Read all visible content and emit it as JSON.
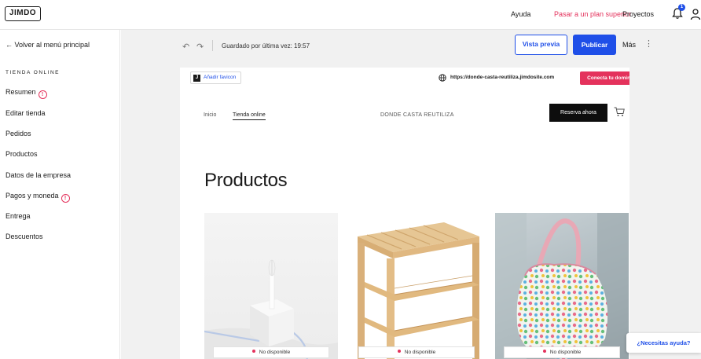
{
  "brand": {
    "logo_text": "JIMDO"
  },
  "topnav": {
    "help": "Ayuda",
    "upgrade": "Pasar a un plan superior",
    "projects": "Proyectos",
    "notification_count": "1"
  },
  "sidebar": {
    "back_label": "← Volver al menú principal",
    "section_title": "TIENDA ONLINE",
    "items": [
      {
        "label": "Resumen",
        "warning": true
      },
      {
        "label": "Editar tienda",
        "warning": false
      },
      {
        "label": "Pedidos",
        "warning": false
      },
      {
        "label": "Productos",
        "warning": false
      },
      {
        "label": "Datos de la empresa",
        "warning": false
      },
      {
        "label": "Pagos y moneda",
        "warning": true
      },
      {
        "label": "Entrega",
        "warning": false
      },
      {
        "label": "Descuentos",
        "warning": false
      }
    ],
    "warning_glyph": "!"
  },
  "toolbar": {
    "undo_icon": "↶",
    "redo_icon": "↷",
    "saved_text": "Guardado por última vez: 19:57",
    "preview_label": "Vista previa",
    "publish_label": "Publicar",
    "more_label": "Más",
    "more_icon": "⋮"
  },
  "site": {
    "favicon_label": "Añadir favicon",
    "favicon_glyph": "J",
    "domain_url": "https://donde-casta-reutiliza.jimdosite.com",
    "connect_domain_label": "Conecta tu dominio",
    "nav": [
      "Inicio",
      "Tienda online"
    ],
    "brand_name": "DONDE CASTA REUTILIZA",
    "reserve_label": "Reserva ahora",
    "products_heading": "Productos",
    "products": [
      {
        "status": "No disponible"
      },
      {
        "status": "No disponible"
      },
      {
        "status": "No disponible"
      }
    ]
  },
  "help": {
    "label": "¿Necesitas ayuda?"
  },
  "colors": {
    "accent_blue": "#1f4fe8",
    "accent_pink": "#e4325c",
    "canvas_gray": "#f1f1f1"
  }
}
